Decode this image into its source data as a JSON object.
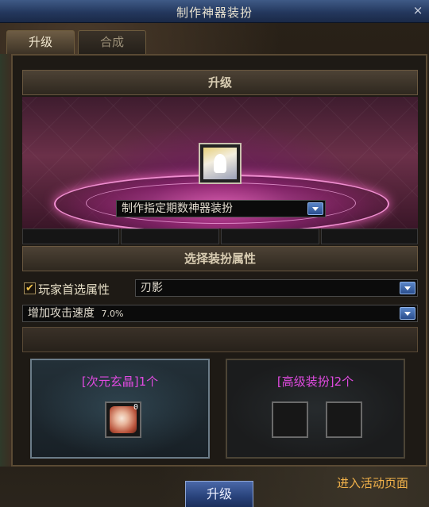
{
  "window": {
    "title": "制作神器装扮",
    "close_glyph": "×"
  },
  "tabs": [
    {
      "label": "升级",
      "active": true
    },
    {
      "label": "合成",
      "active": false
    }
  ],
  "upgrade_section": {
    "header": "升级",
    "item_icon": "white-dragon-costume-icon",
    "period_dropdown": {
      "selected": "制作指定期数神器装扮"
    }
  },
  "attribute_section": {
    "header": "选择装扮属性",
    "preferred": {
      "label": "玩家首选属性",
      "checked": true,
      "selected": "刃影"
    },
    "bonus": {
      "selected": "增加攻击速度",
      "value": "7.0%"
    }
  },
  "materials": [
    {
      "title": "[次元玄晶]1个",
      "slots": [
        {
          "icon": "dimension-crystal-icon",
          "qty": "0"
        }
      ]
    },
    {
      "title": "[高级装扮]2个",
      "slots": [
        {
          "icon": "empty-slot"
        },
        {
          "icon": "empty-slot"
        }
      ]
    }
  ],
  "footer": {
    "upgrade_button": "升级",
    "event_link": "进入活动页面"
  },
  "colors": {
    "title_bar": "#24385e",
    "material_title": "#e04ae0",
    "event_link": "#f2b24a",
    "magic_circle": "#f08ed0"
  }
}
